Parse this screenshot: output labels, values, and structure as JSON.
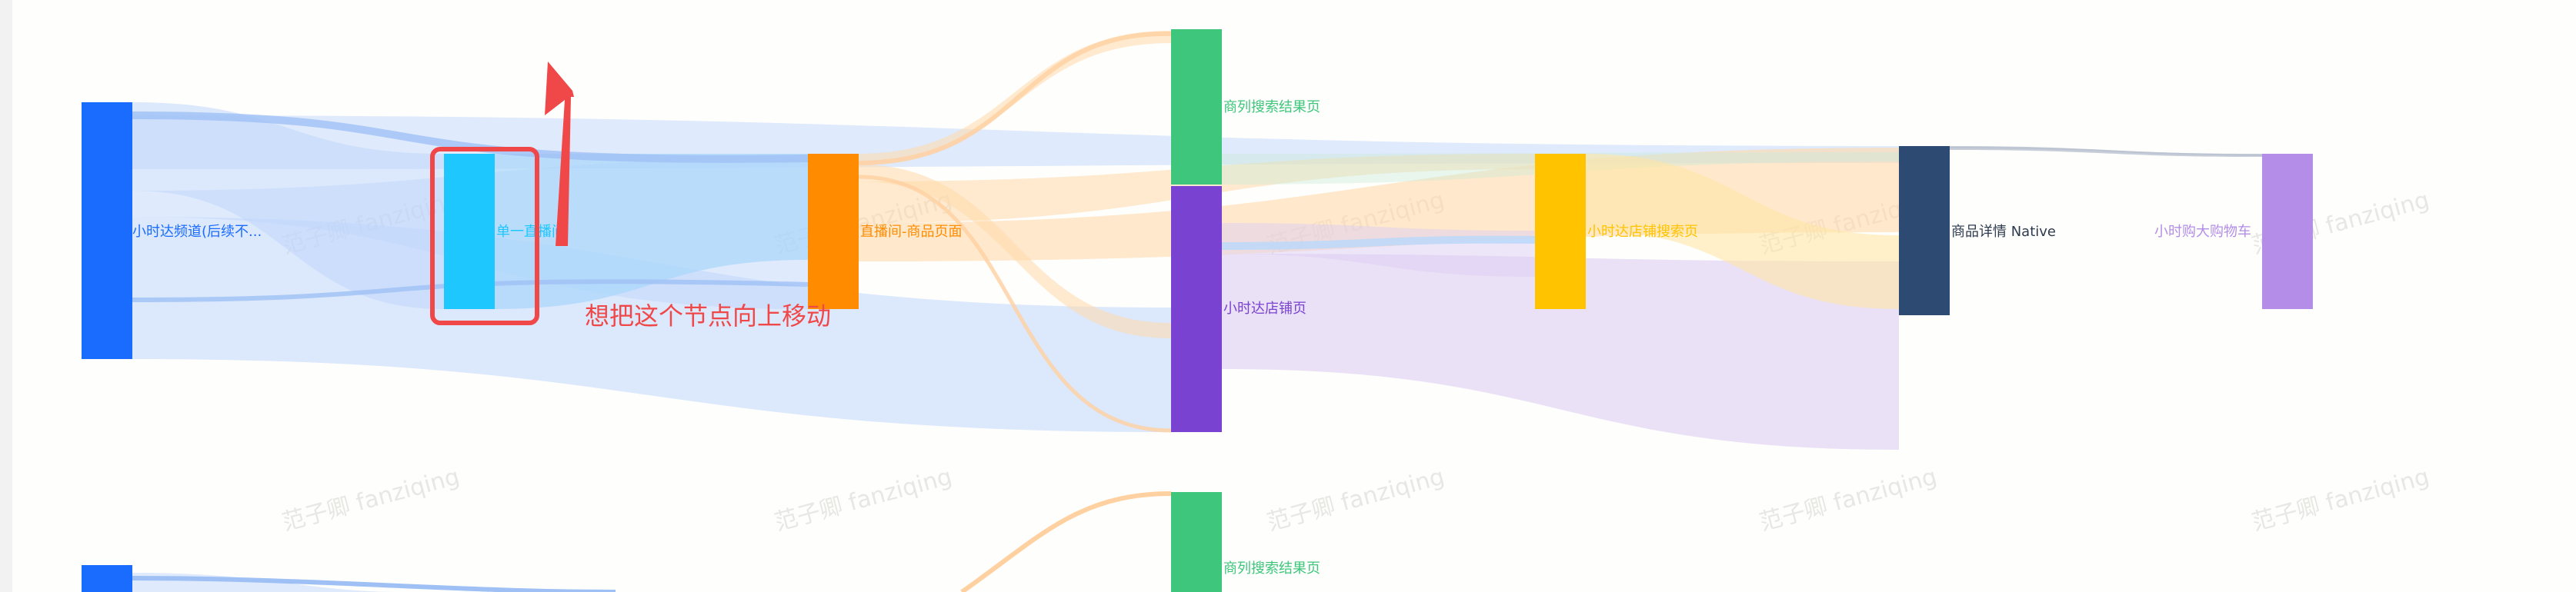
{
  "chart_data": {
    "type": "sankey",
    "nodes": [
      {
        "id": "n0",
        "label": "小时达频道(后续不...",
        "color": "#1a6cff"
      },
      {
        "id": "n1",
        "label": "单一直播间",
        "color": "#1ec8ff"
      },
      {
        "id": "n2",
        "label": "直播间-商品页面",
        "color": "#ff8c00"
      },
      {
        "id": "n3",
        "label": "商列搜索结果页",
        "color": "#3ec67c"
      },
      {
        "id": "n4",
        "label": "小时达店铺页",
        "color": "#7a42d0"
      },
      {
        "id": "n5",
        "label": "小时达店铺搜索页",
        "color": "#ffc300"
      },
      {
        "id": "n6",
        "label": "商品详情 Native",
        "color": "#2d4a73"
      },
      {
        "id": "n7",
        "label": "小时购大购物车",
        "color": "#b38de8"
      }
    ],
    "links": [
      {
        "source": "小时达频道(后续不...",
        "target": "单一直播间",
        "color": "#bfd6fb"
      },
      {
        "source": "小时达频道(后续不...",
        "target": "直播间-商品页面",
        "color": "#bfd6fb"
      },
      {
        "source": "小时达频道(后续不...",
        "target": "小时达店铺页",
        "color": "#bfd6fb"
      },
      {
        "source": "小时达频道(后续不...",
        "target": "商品详情 Native",
        "color": "#bfd6fb"
      },
      {
        "source": "单一直播间",
        "target": "直播间-商品页面",
        "color": "#a8d5fb"
      },
      {
        "source": "直播间-商品页面",
        "target": "商列搜索结果页",
        "color": "#ffd8aa"
      },
      {
        "source": "直播间-商品页面",
        "target": "小时达店铺页",
        "color": "#ffd8aa"
      },
      {
        "source": "直播间-商品页面",
        "target": "小时达店铺搜索页",
        "color": "#ffd8aa"
      },
      {
        "source": "直播间-商品页面",
        "target": "商品详情 Native",
        "color": "#ffd8aa"
      },
      {
        "source": "商列搜索结果页",
        "target": "商品详情 Native",
        "color": "#c8ecd8"
      },
      {
        "source": "小时达店铺页",
        "target": "小时达店铺搜索页",
        "color": "#dccdf3"
      },
      {
        "source": "小时达店铺页",
        "target": "商品详情 Native",
        "color": "#dccdf3"
      },
      {
        "source": "小时达店铺搜索页",
        "target": "商品详情 Native",
        "color": "#ffe6a6"
      },
      {
        "source": "商品详情 Native",
        "target": "小时购大购物车",
        "color": "#b9c2cf"
      }
    ]
  },
  "annotation": {
    "text": "想把这个节点向上移动",
    "color": "#f04848"
  },
  "watermark": {
    "text": "范子卿 fanziqing"
  },
  "second_chart": {
    "label": "商列搜索结果页"
  }
}
